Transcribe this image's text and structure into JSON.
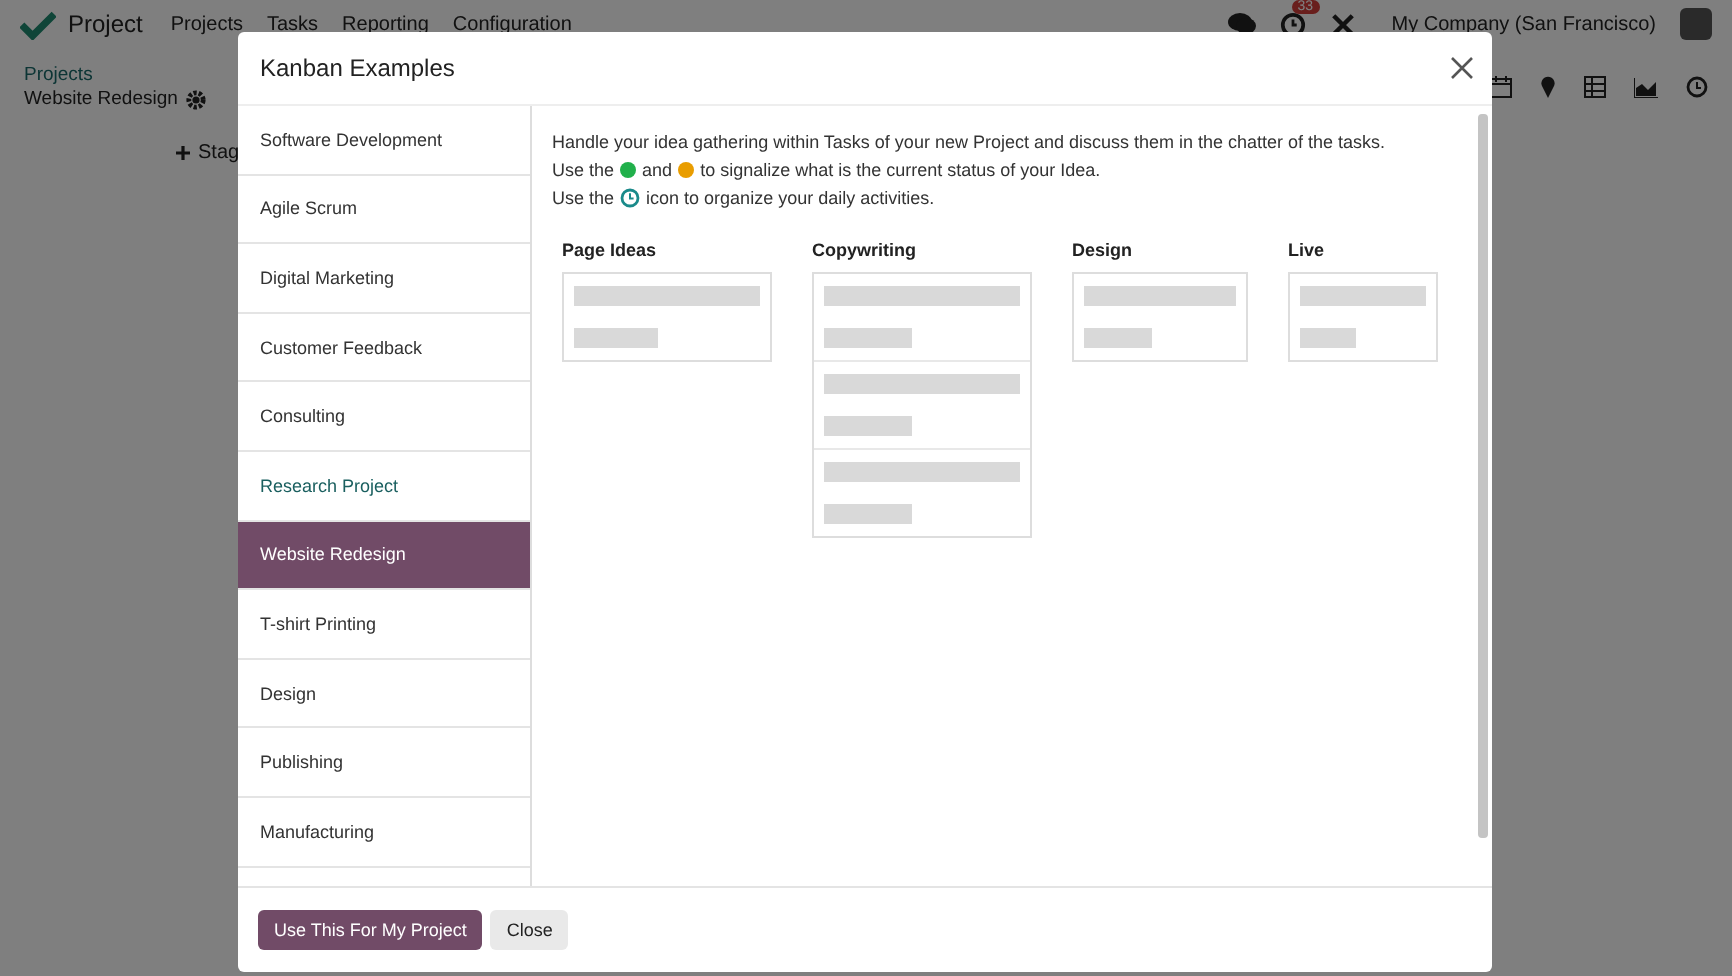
{
  "navbar": {
    "app_name": "Project",
    "menu": [
      "Projects",
      "Tasks",
      "Reporting",
      "Configuration"
    ],
    "activity_count": "33",
    "company": "My Company (San Francisco)"
  },
  "breadcrumb": {
    "parent": "Projects",
    "current": "Website Redesign"
  },
  "stage_button": "Stag",
  "dialog": {
    "title": "Kanban Examples",
    "examples": [
      {
        "label": "Software Development",
        "selected": false,
        "highlighted": false
      },
      {
        "label": "Agile Scrum",
        "selected": false,
        "highlighted": false
      },
      {
        "label": "Digital Marketing",
        "selected": false,
        "highlighted": false
      },
      {
        "label": "Customer Feedback",
        "selected": false,
        "highlighted": false
      },
      {
        "label": "Consulting",
        "selected": false,
        "highlighted": false
      },
      {
        "label": "Research Project",
        "selected": false,
        "highlighted": true
      },
      {
        "label": "Website Redesign",
        "selected": true,
        "highlighted": false
      },
      {
        "label": "T-shirt Printing",
        "selected": false,
        "highlighted": false
      },
      {
        "label": "Design",
        "selected": false,
        "highlighted": false
      },
      {
        "label": "Publishing",
        "selected": false,
        "highlighted": false
      },
      {
        "label": "Manufacturing",
        "selected": false,
        "highlighted": false
      }
    ],
    "description": [
      [
        {
          "kind": "text",
          "text": "Handle your idea gathering within Tasks of your new Project and discuss them in the chatter of the tasks."
        }
      ],
      [
        {
          "kind": "text",
          "text": "Use the"
        },
        {
          "kind": "dot",
          "color": "#21b04b"
        },
        {
          "kind": "text",
          "text": "and"
        },
        {
          "kind": "dot",
          "color": "#e99d00"
        },
        {
          "kind": "text",
          "text": "to signalize what is the current status of your Idea."
        }
      ],
      [
        {
          "kind": "text",
          "text": "Use the"
        },
        {
          "kind": "clock"
        },
        {
          "kind": "text",
          "text": "icon to organize your daily activities."
        }
      ]
    ],
    "columns": [
      {
        "name": "Page Ideas",
        "cards": [
          {
            "kind": "placeholder"
          }
        ]
      },
      {
        "name": "Copywriting",
        "cards": [
          {
            "kind": "placeholder"
          },
          {
            "kind": "placeholder"
          },
          {
            "kind": "placeholder"
          }
        ]
      },
      {
        "name": "Design",
        "cards": [
          {
            "kind": "placeholder"
          }
        ]
      },
      {
        "name": "Live",
        "cards": [
          {
            "kind": "placeholder"
          }
        ]
      }
    ],
    "buttons": [
      {
        "label": "Use This For My Project",
        "kind": "primary"
      },
      {
        "label": "Close",
        "kind": "secondary"
      }
    ]
  }
}
